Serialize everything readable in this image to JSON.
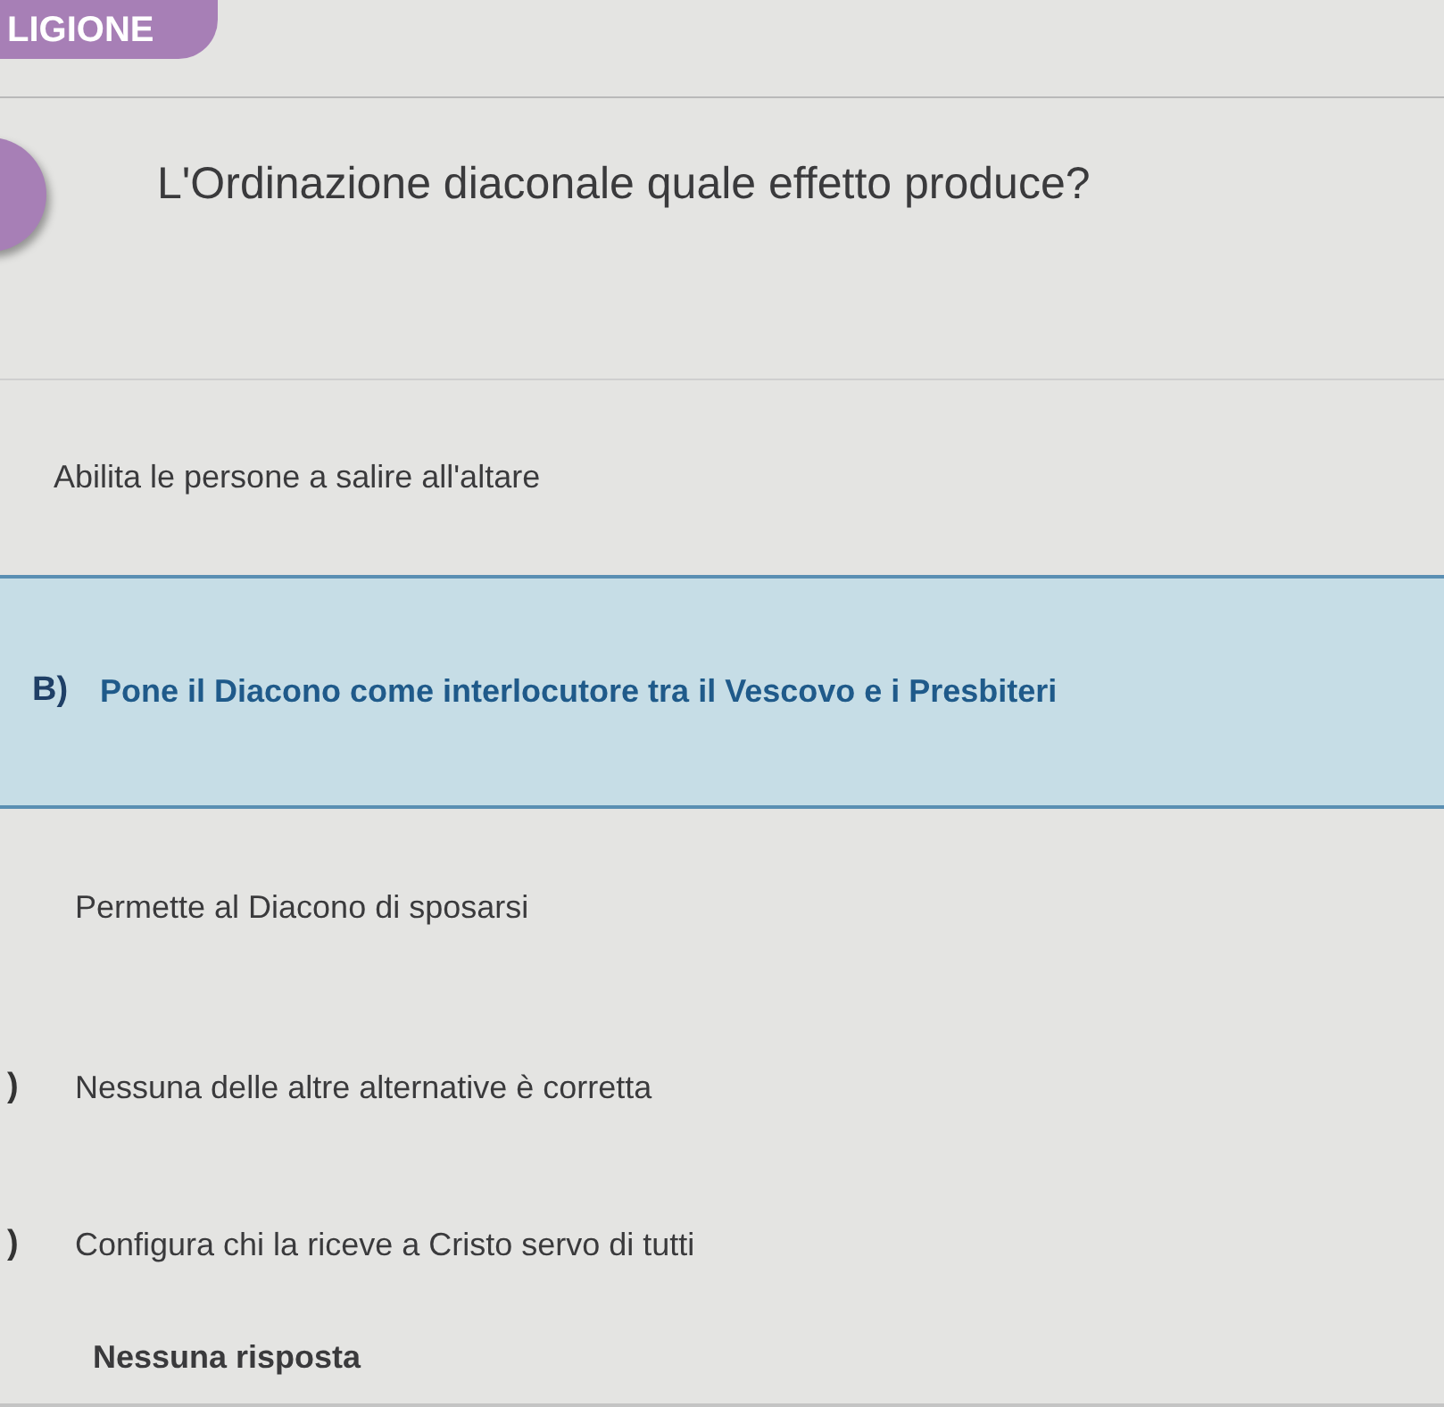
{
  "subject_badge": "LIGIONE",
  "question": {
    "text": "L'Ordinazione diaconale quale effetto produce?"
  },
  "options": [
    {
      "text": "Abilita le persone a salire all'altare",
      "selected": false
    },
    {
      "letter": "B)",
      "text": "Pone il Diacono come interlocutore tra il Vescovo e i Presbiteri",
      "selected": true
    },
    {
      "text": "Permette al Diacono di sposarsi",
      "selected": false
    },
    {
      "letter": ")",
      "text": "Nessuna delle altre alternative è corretta",
      "selected": false
    },
    {
      "letter": ")",
      "text": "Configura chi la riceve a Cristo servo di tutti",
      "selected": false
    }
  ],
  "no_answer": "Nessuna risposta"
}
